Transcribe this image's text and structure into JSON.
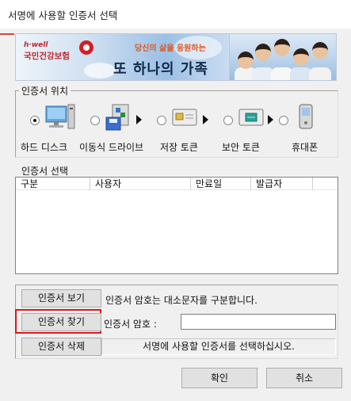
{
  "window": {
    "title": "서명에 사용할 인증서 선택"
  },
  "banner": {
    "brand_small": "h·well",
    "brand_org": "국민건강보험",
    "slogan": "당신의 삶을 응원하는",
    "headline": "또 하나의 가족"
  },
  "location": {
    "group_label": "인증서 위치",
    "options": [
      {
        "label": "하드 디스크",
        "icon": "hard-disk-icon",
        "selected": true
      },
      {
        "label": "이동식 드라이브",
        "icon": "removable-drive-icon",
        "selected": false
      },
      {
        "label": "저장 토큰",
        "icon": "storage-token-icon",
        "selected": false
      },
      {
        "label": "보안 토큰",
        "icon": "security-token-icon",
        "selected": false
      },
      {
        "label": "휴대폰",
        "icon": "mobile-phone-icon",
        "selected": false
      }
    ]
  },
  "cert_list": {
    "label": "인증서 선택",
    "columns": [
      "구분",
      "사용자",
      "만료일",
      "발급자",
      ""
    ],
    "rows": []
  },
  "actions": {
    "view_button": "인증서 보기",
    "find_button": "인증서 찾기",
    "delete_button": "인증서 삭제",
    "case_note": "인증서 암호는 대소문자를 구분합니다.",
    "password_label": "인증서 암호 :",
    "password_value": "",
    "status_text": "서명에 사용할 인증서를 선택하십시오."
  },
  "footer": {
    "ok_button": "확인",
    "cancel_button": "취소"
  },
  "colors": {
    "highlight": "#e0161c",
    "dialog_bg": "#f0f0f0",
    "brand_red": "#c0262d"
  }
}
